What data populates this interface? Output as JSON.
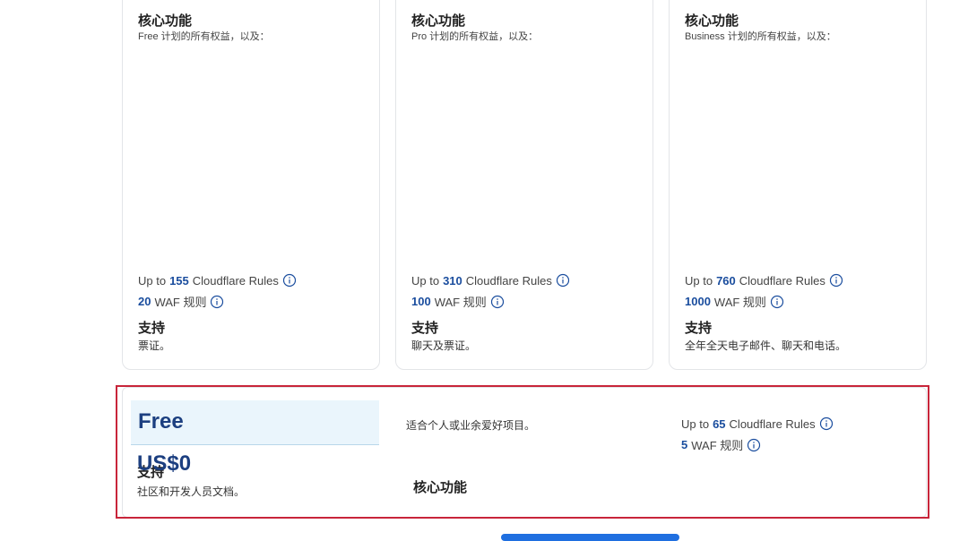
{
  "plans": [
    {
      "core_heading": "核心功能",
      "core_sub": "Free 计划的所有权益，以及：",
      "rules": {
        "prefix": "Up to",
        "value": "155",
        "suffix": "Cloudflare Rules"
      },
      "waf": {
        "value": "20",
        "suffix": "WAF 规则"
      },
      "support_heading": "支持",
      "support_text": "票证。"
    },
    {
      "core_heading": "核心功能",
      "core_sub": "Pro 计划的所有权益，以及：",
      "rules": {
        "prefix": "Up to",
        "value": "310",
        "suffix": "Cloudflare Rules"
      },
      "waf": {
        "value": "100",
        "suffix": "WAF 规则"
      },
      "support_heading": "支持",
      "support_text": "聊天及票证。"
    },
    {
      "core_heading": "核心功能",
      "core_sub": "Business 计划的所有权益，以及：",
      "rules": {
        "prefix": "Up to",
        "value": "760",
        "suffix": "Cloudflare Rules"
      },
      "waf": {
        "value": "1000",
        "suffix": "WAF 规则"
      },
      "support_heading": "支持",
      "support_text": "全年全天电子邮件、聊天和电话。"
    }
  ],
  "free_plan": {
    "name": "Free",
    "price": "US$0",
    "description": "适合个人或业余爱好项目。",
    "core_heading": "核心功能",
    "support_heading": "支持",
    "support_text": "社区和开发人员文档。",
    "rules": {
      "prefix": "Up to",
      "value": "65",
      "suffix": "Cloudflare Rules"
    },
    "waf": {
      "value": "5",
      "suffix": "WAF 规则"
    }
  },
  "icons": {
    "info": "info-circle-icon"
  },
  "colors": {
    "accent": "#1a4d9e",
    "highlight": "#c8253a",
    "band": "#eaf5fc",
    "cta": "#1f6fe0"
  }
}
